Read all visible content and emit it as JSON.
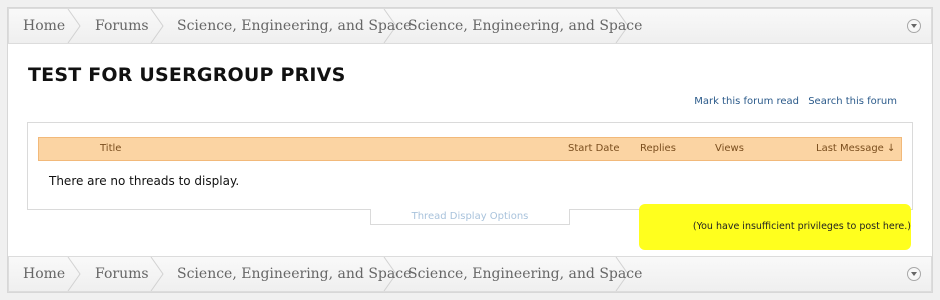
{
  "breadcrumbs": [
    "Home",
    "Forums",
    "Science, Engineering, and Space",
    "Science, Engineering, and Space"
  ],
  "forum_title": "TEST FOR USERGROUP PRIVS",
  "forum_links": {
    "mark_read": "Mark this forum read",
    "search": "Search this forum"
  },
  "thread_list": {
    "columns": {
      "title": "Title",
      "start_date": "Start Date",
      "replies": "Replies",
      "views": "Views",
      "last_message": "Last Message ↓"
    },
    "empty_message": "There are no threads to display."
  },
  "display_options_label": "Thread Display Options",
  "permission_notice": "(You have insufficient privileges to post here.)",
  "colors": {
    "header_row_bg": "#fbd4a3",
    "highlight": "#ffff1e",
    "link": "#2b5a8a"
  }
}
